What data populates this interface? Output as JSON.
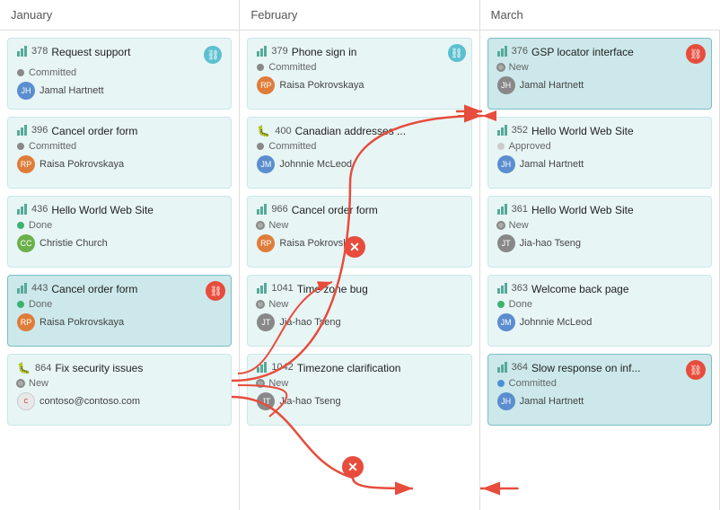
{
  "header": {
    "months": [
      "January",
      "February",
      "March"
    ]
  },
  "columns": {
    "january": {
      "cards": [
        {
          "id": "378",
          "title": "Request support",
          "status": "Committed",
          "status_type": "committed",
          "assignee": "Jamal Hartnett",
          "avatar_color": "blue",
          "has_link": false,
          "highlighted": false
        },
        {
          "id": "396",
          "title": "Cancel order form",
          "status": "Committed",
          "status_type": "committed",
          "assignee": "Raisa Pokrovskaya",
          "avatar_color": "orange",
          "has_link": false,
          "highlighted": false
        },
        {
          "id": "436",
          "title": "Hello World Web Site",
          "status": "Done",
          "status_type": "done",
          "assignee": "Christie Church",
          "avatar_color": "green",
          "has_link": false,
          "highlighted": false
        },
        {
          "id": "443",
          "title": "Cancel order form",
          "status": "Done",
          "status_type": "done",
          "assignee": "Raisa Pokrovskaya",
          "avatar_color": "orange",
          "has_link": true,
          "highlighted": true
        },
        {
          "id": "864",
          "title": "Fix security issues",
          "status": "New",
          "status_type": "new",
          "assignee": "contoso@contoso.com",
          "avatar_color": "red",
          "has_link": false,
          "highlighted": false,
          "is_contoso": true
        }
      ]
    },
    "february": {
      "cards": [
        {
          "id": "379",
          "title": "Phone sign in",
          "status": "Committed",
          "status_type": "committed",
          "assignee": "Raisa Pokrovskaya",
          "avatar_color": "orange",
          "has_link": true,
          "highlighted": false
        },
        {
          "id": "400",
          "title": "Canadian addresses ...",
          "status": "Committed",
          "status_type": "committed",
          "assignee": "Johnnie McLeod",
          "avatar_color": "blue",
          "has_link": false,
          "highlighted": false
        },
        {
          "id": "966",
          "title": "Cancel order form",
          "status": "New",
          "status_type": "new",
          "assignee": "Raisa Pokrovskaya",
          "avatar_color": "orange",
          "has_link": false,
          "highlighted": false
        },
        {
          "id": "1041",
          "title": "Time zone bug",
          "status": "New",
          "status_type": "new",
          "assignee": "Jia-hao Tseng",
          "avatar_color": "gray",
          "has_link": false,
          "highlighted": false
        },
        {
          "id": "1042",
          "title": "Timezone clarification",
          "status": "New",
          "status_type": "new",
          "assignee": "Jia-hao Tseng",
          "avatar_color": "gray",
          "has_link": false,
          "highlighted": false
        }
      ]
    },
    "march": {
      "cards": [
        {
          "id": "376",
          "title": "GSP locator interface",
          "status": "New",
          "status_type": "new",
          "assignee": "Jamal Hartnett",
          "avatar_color": "gray",
          "has_link": true,
          "highlighted": true
        },
        {
          "id": "352",
          "title": "Hello World Web Site",
          "status": "Approved",
          "status_type": "approved",
          "assignee": "Jamal Hartnett",
          "avatar_color": "blue",
          "has_link": false,
          "highlighted": false
        },
        {
          "id": "361",
          "title": "Hello World Web Site",
          "status": "New",
          "status_type": "new",
          "assignee": "Jia-hao Tseng",
          "avatar_color": "gray",
          "has_link": false,
          "highlighted": false
        },
        {
          "id": "363",
          "title": "Welcome back page",
          "status": "Done",
          "status_type": "done",
          "assignee": "Johnnie McLeod",
          "avatar_color": "blue",
          "has_link": false,
          "highlighted": false
        },
        {
          "id": "364",
          "title": "Slow response on inf...",
          "status": "Committed",
          "status_type": "committed-blue",
          "assignee": "Jamal Hartnett",
          "avatar_color": "blue",
          "has_link": true,
          "highlighted": true
        }
      ]
    }
  },
  "icons": {
    "link": "⛓",
    "cross": "✕",
    "bar": "▋"
  }
}
